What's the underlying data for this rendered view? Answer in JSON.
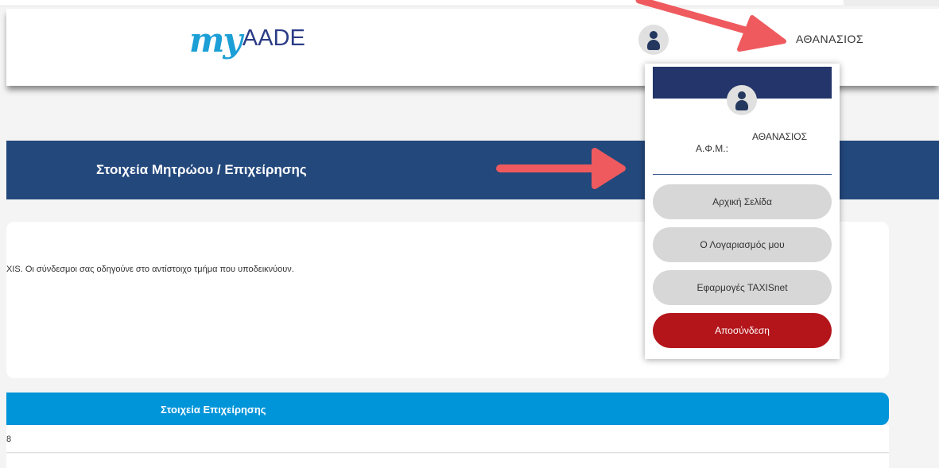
{
  "header": {
    "logo_my": "my",
    "logo_aade": "AADE",
    "user_name": "ΑΘΑΝΑΣΙΟΣ"
  },
  "banner": {
    "title": "Στοιχεία Μητρώου / Επιχείρησης"
  },
  "info_card": {
    "text": "XIS. Οι σύνδεσμοι σας οδηγούνε στο αντίστοιχο τμήμα που υποδεικνύουν."
  },
  "section": {
    "title": "Στοιχεία Επιχείρησης",
    "row_1_value": "8"
  },
  "dropdown": {
    "user_name": "ΑΘΑΝΑΣΙΟΣ",
    "afm_label": "Α.Φ.Μ.:",
    "buttons": [
      {
        "label": "Αρχική Σελίδα"
      },
      {
        "label": "Ο Λογαριασμός μου"
      },
      {
        "label": "Εφαρμογές TAXISnet"
      },
      {
        "label": "Αποσύνδεση"
      }
    ]
  },
  "icons": [
    "user-avatar-icon",
    "arrow-annotation-icon"
  ],
  "colors": {
    "banner": "#23487c",
    "section": "#0094d9",
    "dropdown_header": "#23356a",
    "logout": "#b3151b",
    "annotation_arrow": "#ef5a5e"
  }
}
